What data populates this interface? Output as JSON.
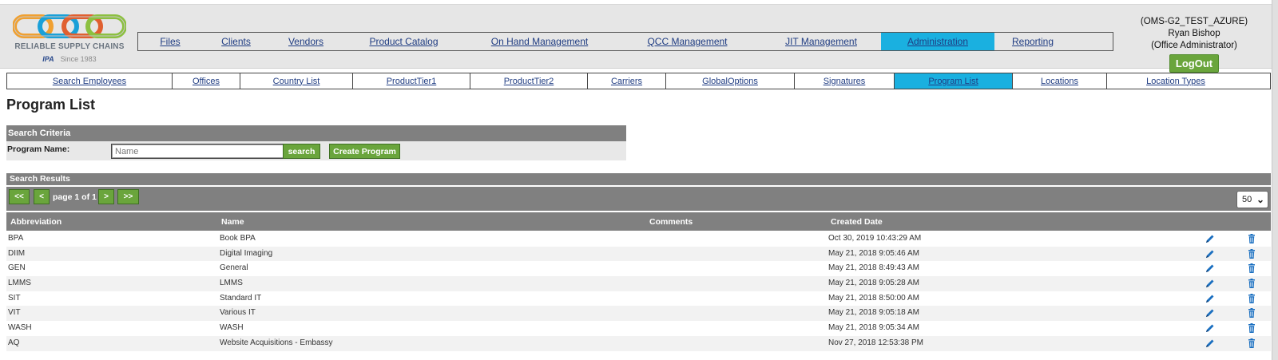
{
  "logo": {
    "name": "RELIABLE SUPPLY CHAINS",
    "since": "Since 1983",
    "partner": "IPA",
    "colors": [
      "#f0a030",
      "#1aa0d8",
      "#e06030",
      "#8cc040"
    ]
  },
  "main_nav": [
    {
      "label": "Files",
      "active": false
    },
    {
      "label": "Clients",
      "active": false
    },
    {
      "label": "Vendors",
      "active": false
    },
    {
      "label": "Product Catalog",
      "active": false
    },
    {
      "label": "On Hand Management",
      "active": false
    },
    {
      "label": "QCC Management",
      "active": false
    },
    {
      "label": "JIT Management",
      "active": false
    },
    {
      "label": "Administration",
      "active": true
    },
    {
      "label": "Reporting",
      "active": false
    }
  ],
  "user": {
    "environment": "(OMS-G2_TEST_AZURE)",
    "name": "Ryan Bishop",
    "role": "(Office Administrator)",
    "logout_label": "LogOut"
  },
  "sub_nav": [
    {
      "label": "Search Employees",
      "active": false
    },
    {
      "label": "Offices",
      "active": false
    },
    {
      "label": "Country List",
      "active": false
    },
    {
      "label": "ProductTier1",
      "active": false
    },
    {
      "label": "ProductTier2",
      "active": false
    },
    {
      "label": "Carriers",
      "active": false
    },
    {
      "label": "GlobalOptions",
      "active": false
    },
    {
      "label": "Signatures",
      "active": false
    },
    {
      "label": "Program List",
      "active": true
    },
    {
      "label": "Locations",
      "active": false
    },
    {
      "label": "Location Types",
      "active": false
    }
  ],
  "page_title": "Program List",
  "search": {
    "header": "Search Criteria",
    "program_name_label": "Program Name:",
    "placeholder": "Name",
    "value": "",
    "search_label": "search",
    "create_label": "Create Program"
  },
  "results": {
    "header": "Search Results",
    "pager": {
      "first": "<<",
      "prev": "<",
      "text": "page 1 of 1",
      "next": ">",
      "last": ">>"
    },
    "page_size": "50",
    "columns": {
      "abbreviation": "Abbreviation",
      "name": "Name",
      "comments": "Comments",
      "created_date": "Created Date"
    },
    "rows": [
      {
        "abbreviation": "BPA",
        "name": "Book BPA",
        "comments": "",
        "created_date": "Oct 30, 2019 10:43:29 AM"
      },
      {
        "abbreviation": "DIIM",
        "name": "Digital Imaging",
        "comments": "",
        "created_date": "May 21, 2018 9:05:46 AM"
      },
      {
        "abbreviation": "GEN",
        "name": "General",
        "comments": "",
        "created_date": "May 21, 2018 8:49:43 AM"
      },
      {
        "abbreviation": "LMMS",
        "name": "LMMS",
        "comments": "",
        "created_date": "May 21, 2018 9:05:28 AM"
      },
      {
        "abbreviation": "SIT",
        "name": "Standard IT",
        "comments": "",
        "created_date": "May 21, 2018 8:50:00 AM"
      },
      {
        "abbreviation": "VIT",
        "name": "Various IT",
        "comments": "",
        "created_date": "May 21, 2018 9:05:18 AM"
      },
      {
        "abbreviation": "WASH",
        "name": "WASH",
        "comments": "",
        "created_date": "May 21, 2018 9:05:34 AM"
      },
      {
        "abbreviation": "AQ",
        "name": "Website Acquisitions - Embassy",
        "comments": "",
        "created_date": "Nov 27, 2018 12:53:38 PM"
      }
    ],
    "row_icons": {
      "edit": "pencil-icon",
      "delete": "trash-icon",
      "color": "#1a6fc0"
    }
  }
}
